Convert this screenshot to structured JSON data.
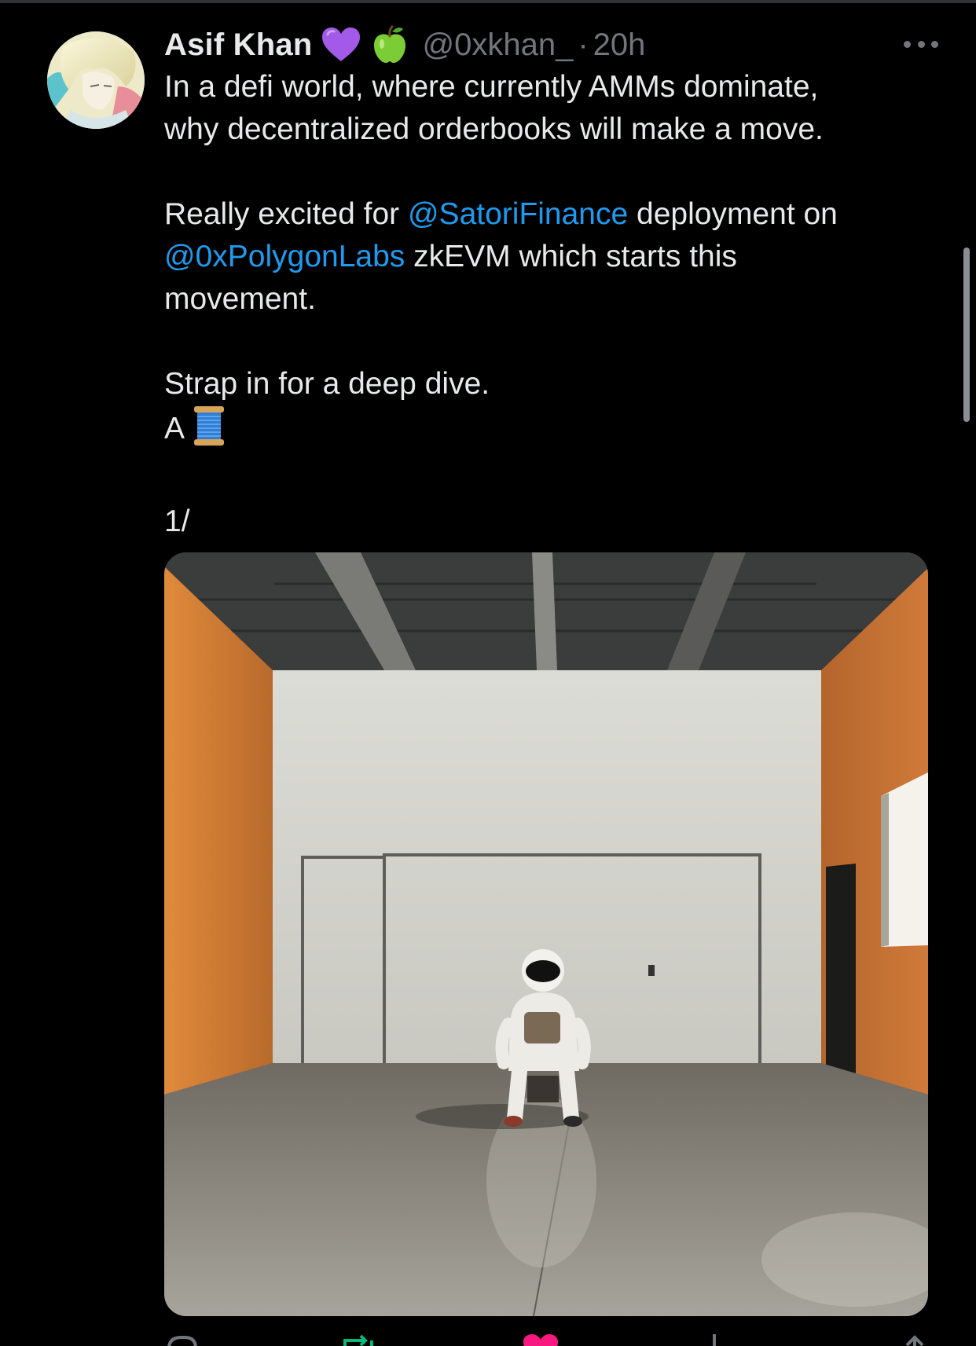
{
  "tweet": {
    "author_name": "Asif Khan",
    "badges": [
      "purple-heart-icon",
      "green-apple-icon"
    ],
    "handle": "@0xkhan_",
    "separator": "·",
    "timestamp": "20h",
    "body": {
      "line1": "In a defi world, where currently AMMs dominate,",
      "line2": "why decentralized orderbooks will make a move.",
      "line3_pre": "Really excited for ",
      "line3_mention": "@SatoriFinance",
      "line3_post": " deployment on",
      "line4_mention": "@0xPolygonLabs",
      "line4_post": " zkEVM which starts this",
      "line5": "movement.",
      "line6": "Strap in for a deep dive.",
      "line7": "A",
      "line8": "1/"
    },
    "thread_icon": "spool-of-thread-icon"
  },
  "colors": {
    "background": "#000000",
    "text": "#e7e9ea",
    "muted": "#71767b",
    "link": "#1d9bf0"
  }
}
